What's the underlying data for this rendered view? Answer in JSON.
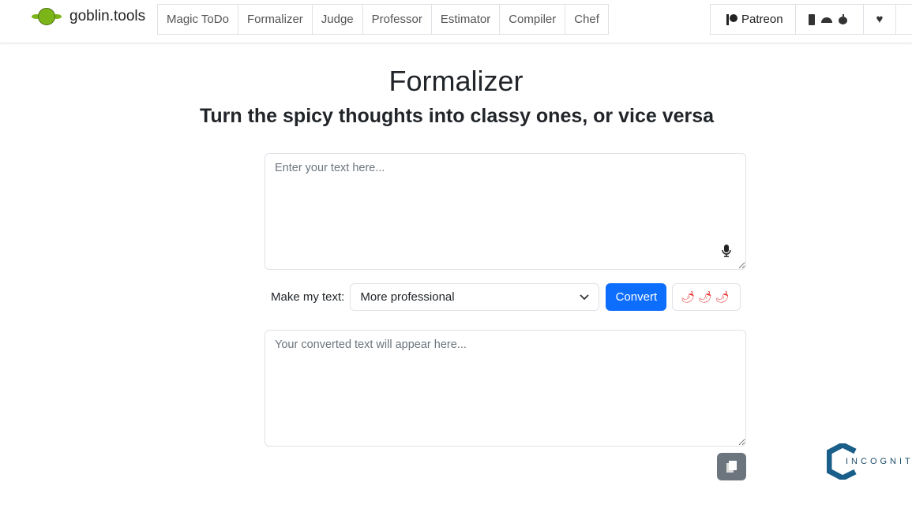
{
  "brand": {
    "name": "goblin.tools"
  },
  "nav": {
    "tabs": [
      "Magic ToDo",
      "Formalizer",
      "Judge",
      "Professor",
      "Estimator",
      "Compiler",
      "Chef"
    ],
    "patreon": "Patreon"
  },
  "page": {
    "title": "Formalizer",
    "subtitle": "Turn the spicy thoughts into classy ones, or vice versa"
  },
  "input": {
    "placeholder": "Enter your text here...",
    "value": ""
  },
  "controls": {
    "label": "Make my text:",
    "selected": "More professional",
    "convert": "Convert",
    "spiciness": "🌶🌶🌶"
  },
  "output": {
    "placeholder": "Your converted text will appear here...",
    "value": ""
  },
  "watermark": {
    "text": "INCOGNITO"
  },
  "colors": {
    "primary": "#0d6efd",
    "secondary": "#6c757d"
  }
}
